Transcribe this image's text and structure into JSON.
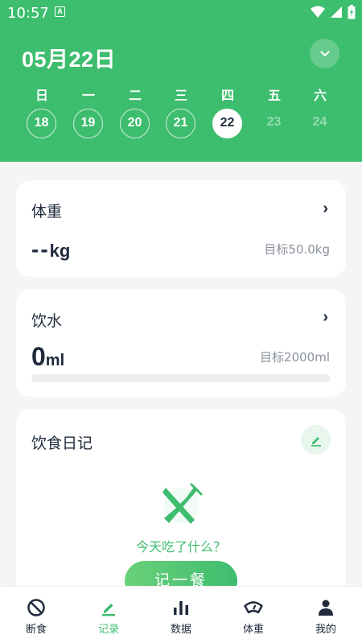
{
  "status_bar": {
    "time": "10:57",
    "notification_icon": "A"
  },
  "header": {
    "date_title": "05月22日",
    "weekdays": [
      "日",
      "一",
      "二",
      "三",
      "四",
      "五",
      "六"
    ],
    "days": [
      "18",
      "19",
      "20",
      "21",
      "22",
      "23",
      "24"
    ],
    "selected_day": "22",
    "future_days": [
      "23",
      "24"
    ]
  },
  "weight_card": {
    "title": "体重",
    "value": "--",
    "unit": "kg",
    "goal": "目标50.0kg"
  },
  "water_card": {
    "title": "饮水",
    "value": "0",
    "unit": "ml",
    "goal": "目标2000ml",
    "progress": 0
  },
  "diet_card": {
    "title": "饮食日记",
    "empty_text": "今天吃了什么？",
    "button_label": "记一餐"
  },
  "bottom_nav": {
    "items": [
      {
        "label": "断食",
        "icon": "block-icon"
      },
      {
        "label": "记录",
        "icon": "edit-icon"
      },
      {
        "label": "数据",
        "icon": "bar-chart-icon"
      },
      {
        "label": "体重",
        "icon": "scale-icon"
      },
      {
        "label": "我的",
        "icon": "person-icon"
      }
    ],
    "active": "记录"
  },
  "colors": {
    "accent": "#3dbd6e",
    "text": "#1f2a3c",
    "muted": "#8a919c",
    "background": "#f5f5f5"
  }
}
